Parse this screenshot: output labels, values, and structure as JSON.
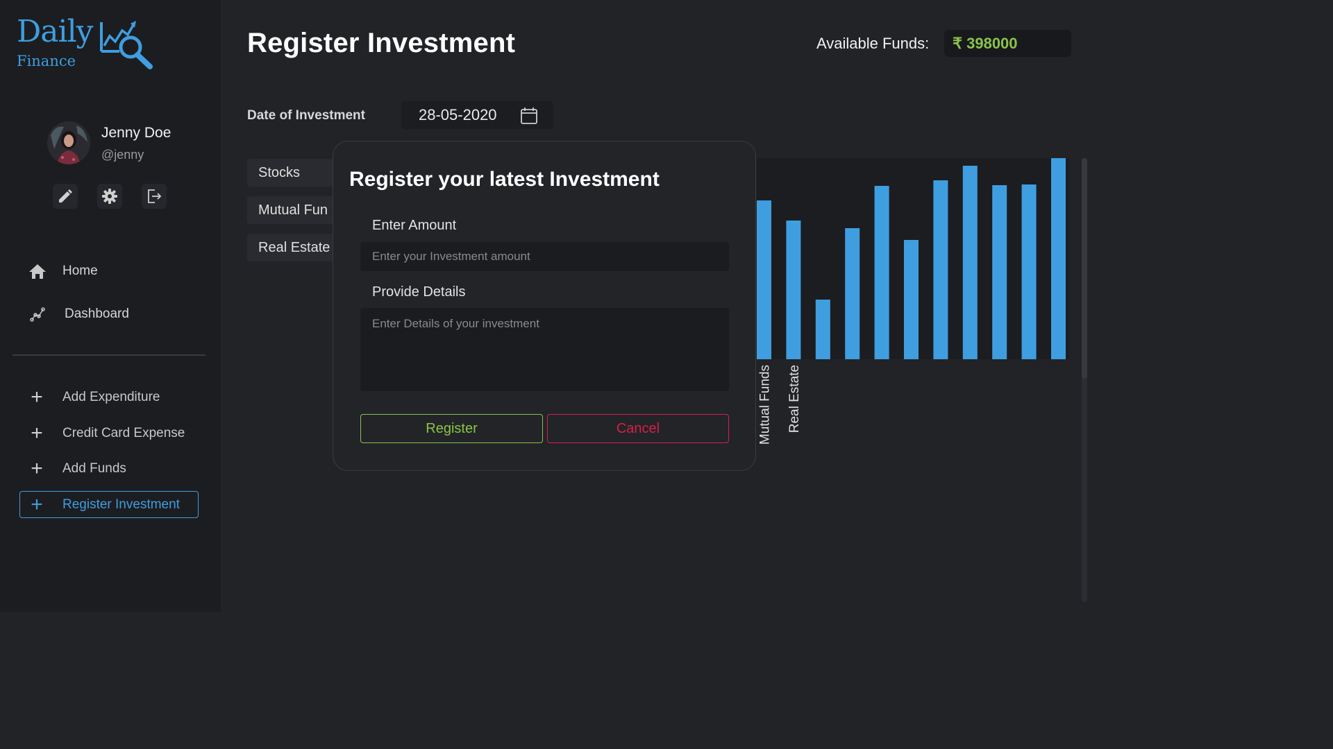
{
  "app": {
    "logo_title": "Daily",
    "logo_subtitle": "Finance"
  },
  "user": {
    "name": "Jenny Doe",
    "handle": "@jenny"
  },
  "profile_actions": [
    {
      "icon": "pencil-icon"
    },
    {
      "icon": "gear-icon"
    },
    {
      "icon": "logout-icon"
    }
  ],
  "nav": {
    "home": "Home",
    "dashboard": "Dashboard"
  },
  "actions": {
    "add_expenditure": "Add Expenditure",
    "credit_card_expense": "Credit Card Expense",
    "add_funds": "Add Funds",
    "register_investment": "Register Investment"
  },
  "header": {
    "title": "Register Investment",
    "funds_label": "Available Funds:",
    "funds_value": "₹ 398000"
  },
  "form": {
    "date_label": "Date of Investment",
    "date_value": "28-05-2020"
  },
  "categories": [
    "Stocks",
    "Mutual Fun",
    "Real Estate"
  ],
  "chart_data": {
    "type": "bar",
    "categories": [
      "Mutual Funds",
      "Real Estate",
      "",
      "",
      "",
      "",
      "",
      "",
      "",
      "",
      ""
    ],
    "values": [
      229,
      200,
      86,
      189,
      250,
      172,
      258,
      279,
      251,
      252,
      290
    ],
    "title": "",
    "xlabel": "",
    "ylabel": "",
    "color": "#3f9ee0"
  },
  "modal": {
    "title": "Register your latest Investment",
    "amount_label": "Enter Amount",
    "amount_placeholder": "Enter your Investment amount",
    "details_label": "Provide Details",
    "details_placeholder": "Enter Details of your investment",
    "register_label": "Register",
    "cancel_label": "Cancel"
  },
  "colors": {
    "accent": "#3f9ee0",
    "funds": "#8bc34a",
    "danger": "#d61f4a"
  }
}
